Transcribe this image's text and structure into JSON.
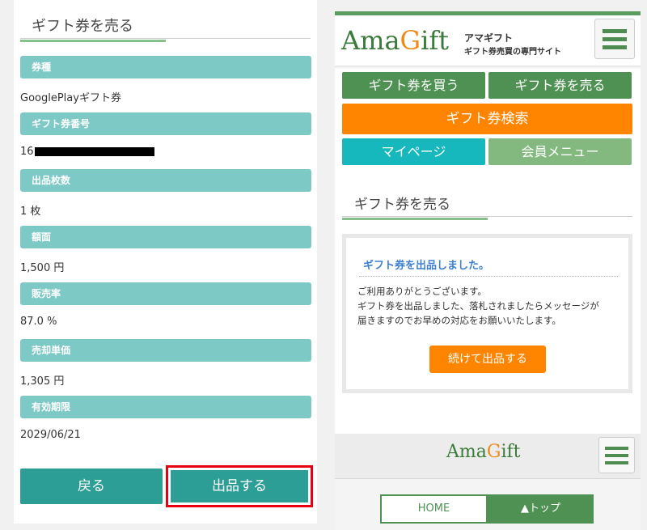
{
  "left_panel": {
    "title": "ギフト券を売る",
    "fields": [
      {
        "label": "券種",
        "value": "GooglePlayギフト券"
      },
      {
        "label": "ギフト券番号",
        "value": "16"
      },
      {
        "label": "出品枚数",
        "value": "1 枚"
      },
      {
        "label": "額面",
        "value": "1,500 円"
      },
      {
        "label": "販売率",
        "value": "87.0 %"
      },
      {
        "label": "売却単価",
        "value": "1,305 円"
      },
      {
        "label": "有効期限",
        "value": "2029/06/21"
      }
    ],
    "back_label": "戻る",
    "submit_label": "出品する"
  },
  "right_panel": {
    "logo": {
      "pre": "Ama",
      "accent": "G",
      "post": "ift"
    },
    "logo_subtitle_1": "アマギフト",
    "logo_subtitle_2": "ギフト券売買の専門サイト",
    "nav": {
      "buy": "ギフト券を買う",
      "sell": "ギフト券を売る",
      "search": "ギフト券検索",
      "mypage": "マイページ",
      "member_menu": "会員メニュー"
    },
    "page_title": "ギフト券を売る",
    "message": {
      "title": "ギフト券を出品しました。",
      "line1": "ご利用ありがとうございます。",
      "line2": "ギフト券を出品しました、落札されましたらメッセージが",
      "line3": "届きますのでお早めの対応をお願いいたします。",
      "continue_label": "続けて出品する"
    },
    "footer": {
      "logo": {
        "pre": "Ama",
        "accent": "G",
        "post": "ift"
      },
      "home_label": "HOME",
      "top_label": "▲トップ"
    }
  },
  "colors": {
    "teal_button": "#2c9e96",
    "field_header": "#7dc9c5",
    "green_nav": "#4e9153",
    "orange": "#ff8400",
    "cyan": "#17b8bd",
    "light_green": "#83b97f",
    "highlight_red": "#e60012",
    "message_blue": "#3c7fd1"
  }
}
